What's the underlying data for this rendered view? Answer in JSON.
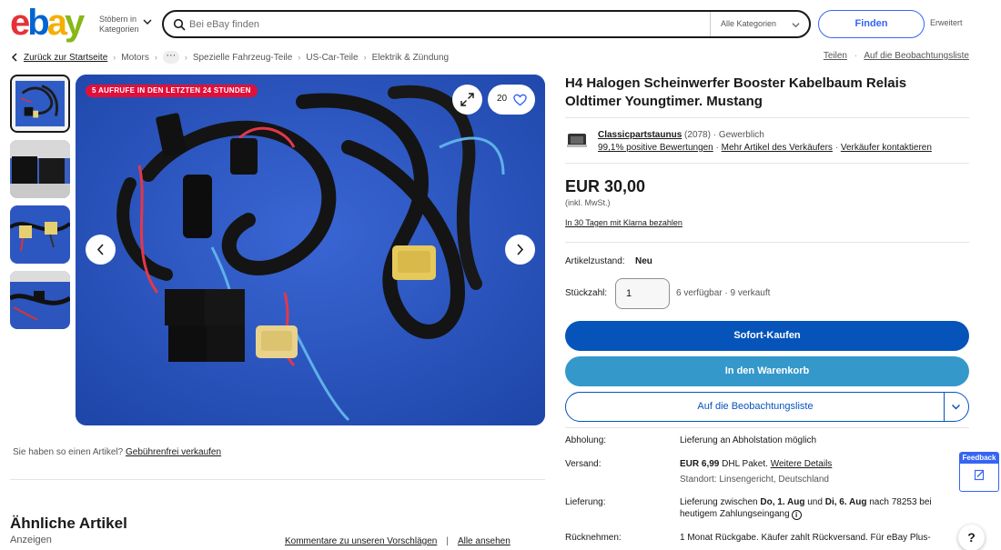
{
  "header": {
    "logo_letters": [
      "e",
      "b",
      "a",
      "y"
    ],
    "browse_label": "Stöbern in Kategorien",
    "search_placeholder": "Bei eBay finden",
    "category_select": "Alle Kategorien",
    "find_button": "Finden",
    "advanced_link": "Erweitert"
  },
  "breadcrumb": {
    "back": "Zurück zur Startseite",
    "items": [
      "Motors",
      "Spezielle Fahrzeug-Teile",
      "US-Car-Teile",
      "Elektrik & Zündung"
    ],
    "share": "Teilen",
    "watchlist": "Auf die Beobachtungsliste"
  },
  "gallery": {
    "views_badge": "5 AUFRUFE IN DEN LETZTEN 24 STUNDEN",
    "watch_count": "20",
    "sell_prompt": "Sie haben so einen Artikel?",
    "sell_link": "Gebührenfrei verkaufen"
  },
  "similar": {
    "title": "Ähnliche Artikel",
    "ads_label": "Anzeigen",
    "feedback_link": "Kommentare zu unseren Vorschlägen",
    "separator": "|",
    "see_all": "Alle ansehen"
  },
  "item": {
    "title": "H4 Halogen Scheinwerfer Booster Kabelbaum Relais Oldtimer Youngtimer. Mustang",
    "seller": {
      "name": "Classicpartstaunus",
      "rating_count": "(2078)",
      "type": "· Gewerblich",
      "positive": "99,1% positive Bewertungen",
      "more_items": "Mehr Artikel des Verkäufers",
      "contact": "Verkäufer kontaktieren"
    },
    "price": "EUR 30,00",
    "tax_note": "(inkl. MwSt.)",
    "klarna": "In 30 Tagen mit Klarna bezahlen",
    "condition_label": "Artikelzustand:",
    "condition_value": "Neu",
    "quantity_label": "Stückzahl:",
    "quantity_value": "1",
    "availability": "6 verfügbar",
    "sold": "· 9 verkauft",
    "buy_now": "Sofort-Kaufen",
    "add_to_cart": "In den Warenkorb",
    "add_to_watchlist": "Auf die Beobachtungsliste"
  },
  "details": {
    "pickup_label": "Abholung:",
    "pickup_value": "Lieferung an Abholstation möglich",
    "shipping_label": "Versand:",
    "shipping_price": "EUR 6,99",
    "shipping_method": "DHL Paket.",
    "shipping_more": "Weitere Details",
    "location": "Standort: Linsengericht, Deutschland",
    "delivery_label": "Lieferung:",
    "delivery_line1_a": "Lieferung zwischen",
    "delivery_date1": "Do, 1. Aug",
    "delivery_and": "und",
    "delivery_date2": "Di, 6. Aug",
    "delivery_line1_b": "nach 78253 bei",
    "delivery_line2": "heutigem Zahlungseingang",
    "returns_label": "Rücknehmen:",
    "returns_value": "1 Monat Rückgabe. Käufer zahlt Rückversand. Für eBay Plus-"
  },
  "widgets": {
    "feedback": "Feedback",
    "help": "?"
  },
  "colors": {
    "buy_button": "#0654ba",
    "cart_button": "#3498ca",
    "badge": "#e0103a",
    "link_blue": "#3665f3"
  }
}
